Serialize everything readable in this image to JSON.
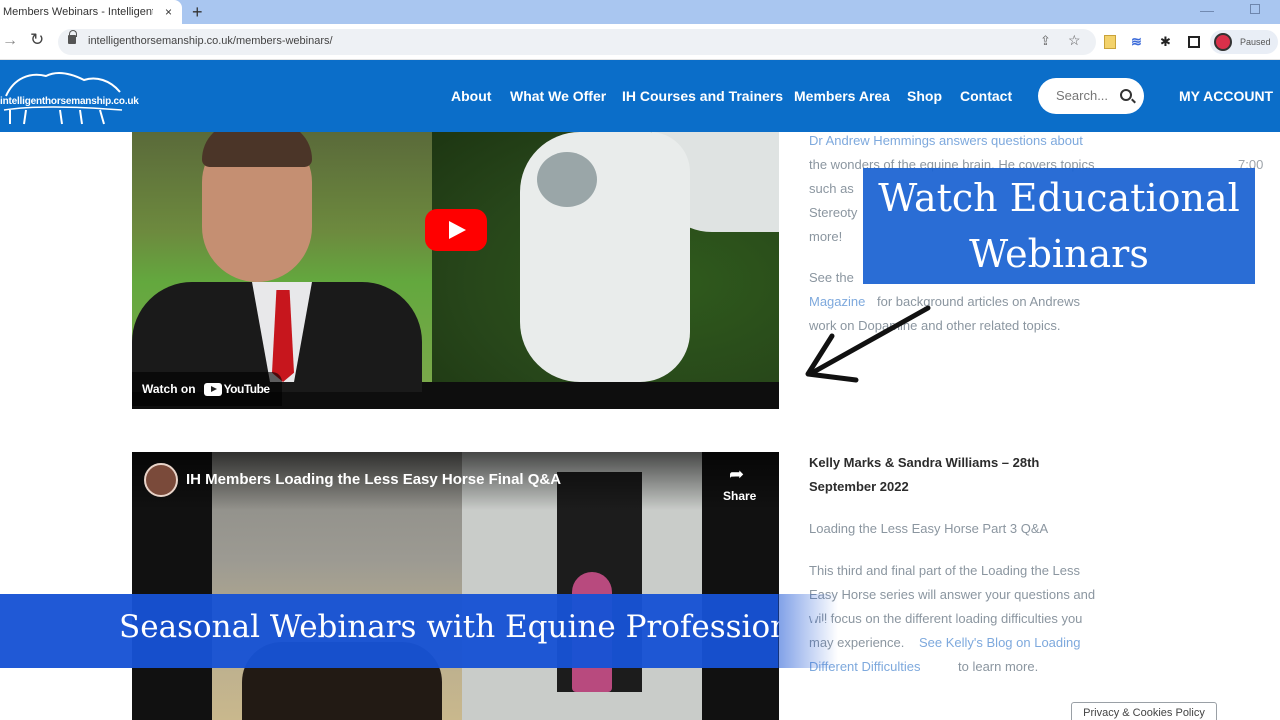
{
  "browser": {
    "tab_title": "Members Webinars - Intelligent",
    "tab_close": "×",
    "new_tab": "+",
    "url": "intelligenthorsemanship.co.uk/members-webinars/",
    "profile_status": "Paused"
  },
  "site": {
    "logo_text": "intelligenthorsemanship.co.uk",
    "nav": [
      "About",
      "What We Offer",
      "IH Courses and Trainers",
      "Members Area",
      "Shop",
      "Contact"
    ],
    "search_placeholder": "Search...",
    "account_label": "MY ACCOUNT"
  },
  "video1": {
    "watch_on": "Watch on",
    "youtube": "YouTube"
  },
  "article1": {
    "lines": [
      "Dr Andrew Hemmings answers questions about",
      "the wonders of the equine brain. He covers topics",
      "such as",
      "Stereoty",
      "more!"
    ],
    "see_prefix": "See the",
    "magazine_link": "Magazine",
    "magazine_rest": "for background articles on Andrews",
    "work_line": "work on Dopamine and other related topics.",
    "time": "7:00"
  },
  "overlay": {
    "top_line1": "Watch Educational",
    "top_line2": "Webinars",
    "bottom": "Seasonal Webinars with Equine Professionals"
  },
  "video2": {
    "title": "IH Members Loading the Less Easy Horse Final Q&A",
    "share": "Share"
  },
  "article2": {
    "heading_line1": "Kelly Marks & Sandra Williams – 28th",
    "heading_line2": "September 2022",
    "subtitle": "Loading the Less Easy Horse Part 3 Q&A",
    "p1": "This third and final part of the Loading the Less",
    "p2": "Easy Horse series will answer your questions and",
    "p3": "will focus on the different loading difficulties you",
    "p4_text": "may experience.",
    "p4_link": "See Kelly's Blog on Loading",
    "p5_link": "Different Difficulties",
    "p5_text": "to learn more."
  },
  "cookie_label": "Privacy & Cookies Policy"
}
